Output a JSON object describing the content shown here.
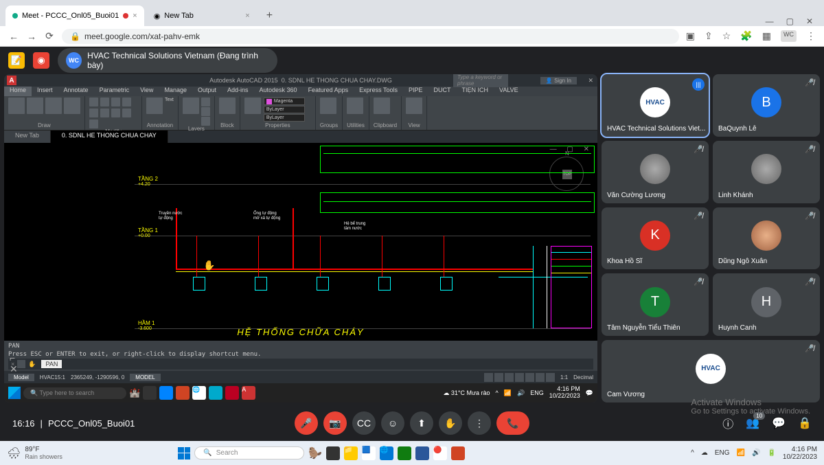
{
  "browser": {
    "tabs": [
      {
        "title": "Meet - PCCC_Onl05_Buoi01"
      },
      {
        "title": "New Tab"
      }
    ],
    "url": "meet.google.com/xat-pahv-emk"
  },
  "meet": {
    "presenter_badge": "WC",
    "presenter_name": "HVAC Technical Solutions Vietnam (Đang trình bày)",
    "time": "16:16",
    "meeting_name": "PCCC_Onl05_Buoi01",
    "participants_count": "10"
  },
  "participants": [
    {
      "name": "HVAC Technical Solutions Viet...",
      "avatar": "HVAC",
      "color": "#fff",
      "speaking": true
    },
    {
      "name": "BaQuynh Lê",
      "avatar": "B",
      "color": "#1a73e8",
      "muted": true
    },
    {
      "name": "Văn Cường Lương",
      "avatar": "img",
      "muted": true
    },
    {
      "name": "Linh Khánh",
      "avatar": "img",
      "muted": true
    },
    {
      "name": "Khoa Hồ Sĩ",
      "avatar": "K",
      "color": "#d93025",
      "muted": true
    },
    {
      "name": "Dũng Ngô Xuân",
      "avatar": "img",
      "muted": true
    },
    {
      "name": "Tâm Nguyễn Tiểu Thiên",
      "avatar": "T",
      "color": "#188038",
      "muted": true
    },
    {
      "name": "Huynh Canh",
      "avatar": "H",
      "color": "#5f6368",
      "muted": true
    },
    {
      "name": "Cam Vương",
      "avatar": "HVAC",
      "color": "#fff",
      "muted": true
    }
  ],
  "autocad": {
    "app_title": "Autodesk AutoCAD 2015",
    "file": "0. SDNL HE THONG CHUA CHAY.DWG",
    "search_ph": "Type a keyword or phrase",
    "signin": "Sign In",
    "menu": [
      "Home",
      "Insert",
      "Annotate",
      "Parametric",
      "View",
      "Manage",
      "Output",
      "Add-ins",
      "Autodesk 360",
      "Featured Apps",
      "Express Tools",
      "PIPE",
      "DUCT",
      "TIỆN ÍCH",
      "VALVE"
    ],
    "ribbon_groups": [
      "Draw",
      "Modify",
      "Annotation",
      "Layers",
      "Block",
      "Properties",
      "Groups",
      "Utilities",
      "Clipboard",
      "View"
    ],
    "ribbon_tools": {
      "line": "Line",
      "polyline": "Polyline",
      "circle": "Circle",
      "arc": "Arc",
      "move": "Move",
      "text": "Text",
      "layer_props": "Layer Properties",
      "insert": "Insert",
      "match": "Match Properties",
      "measure": "Measure",
      "paste": "Paste",
      "base": "Base"
    },
    "layer_color": "Magenta",
    "bylayer": "ByLayer",
    "tabs": [
      "New Tab",
      "0. SDNL HE THONG CHUA CHAY"
    ],
    "floors": [
      {
        "name": "TẦNG 2",
        "elev": "+4.20"
      },
      {
        "name": "TẦNG 1",
        "elev": "+0.00"
      },
      {
        "name": "HẦM 1",
        "elev": "-3.600"
      }
    ],
    "drawing_title": "HỆ THỐNG CHỮA CHÁY",
    "compass_top": "TOP",
    "cmd_mode": "PAN",
    "cmd_line1": "PAN",
    "cmd_line2": "Press ESC or ENTER to exit, or right-click to display shortcut menu.",
    "status": {
      "model": "Model",
      "layout": "HVAC15:1",
      "coords": "2365249, -1290596, 0",
      "mode": "MODEL",
      "scale": "1:1",
      "dec": "Decimal"
    }
  },
  "shared_taskbar": {
    "search_ph": "Type here to search",
    "weather": "31°C  Mưa rào",
    "lang": "ENG",
    "time": "4:16 PM",
    "date": "10/22/2023"
  },
  "activate": {
    "l1": "Activate Windows",
    "l2": "Go to Settings to activate Windows."
  },
  "host_taskbar": {
    "temp": "89°F",
    "cond": "Rain showers",
    "search": "Search",
    "lang": "ENG",
    "time": "4:16 PM",
    "date": "10/22/2023"
  }
}
